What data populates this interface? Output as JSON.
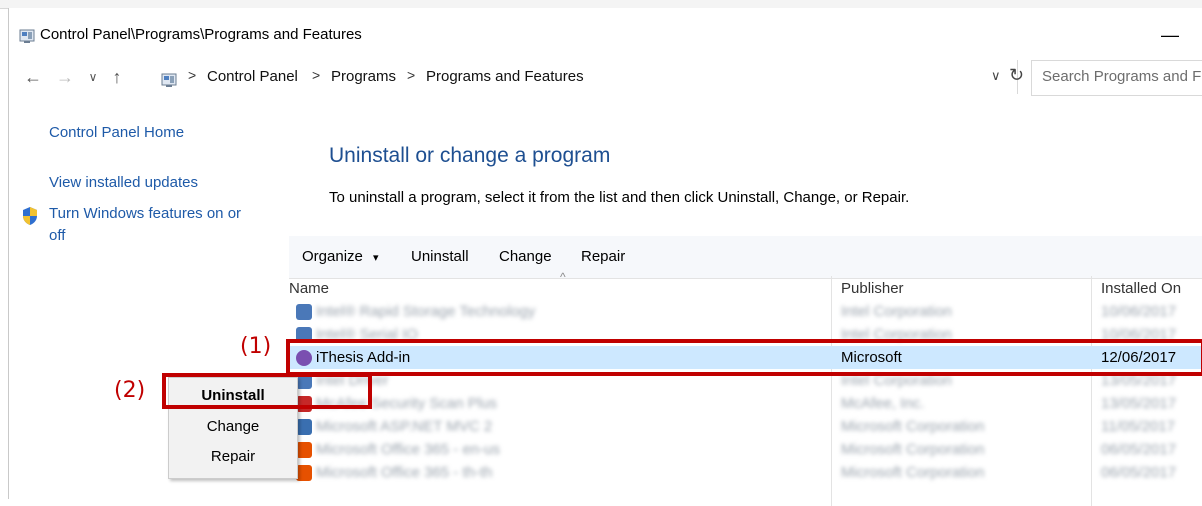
{
  "window": {
    "title": "Control Panel\\Programs\\Programs and Features",
    "minimize_label": "—"
  },
  "address": {
    "crumbs": [
      "Control Panel",
      "Programs",
      "Programs and Features"
    ],
    "separator": ">",
    "dropdown_glyph": "∨",
    "refresh_glyph": "↻",
    "nav": {
      "back": "←",
      "forward": "→",
      "recent": "∨",
      "up": "↑"
    }
  },
  "search": {
    "placeholder": "Search Programs and F"
  },
  "sidebar": {
    "items": [
      {
        "label": "Control Panel Home"
      },
      {
        "label": "View installed updates"
      },
      {
        "label": "Turn Windows features on or",
        "label2": "off",
        "icon": "shield-icon"
      }
    ]
  },
  "main": {
    "title": "Uninstall or change a program",
    "subtitle": "To uninstall a program, select it from the list and then click Uninstall, Change, or Repair."
  },
  "toolbar": {
    "organize": "Organize",
    "organize_caret": "▾",
    "uninstall": "Uninstall",
    "change": "Change",
    "repair": "Repair"
  },
  "table": {
    "columns": [
      "Name",
      "Publisher",
      "Installed On"
    ],
    "sort_glyph": "^",
    "rows": [
      {
        "name": "Intel® Rapid Storage Technology",
        "publisher": "Intel Corporation",
        "date": "10/06/2017",
        "blurred": true,
        "icon_color": "#4a78b8"
      },
      {
        "name": "Intel® Serial IO",
        "publisher": "Intel Corporation",
        "date": "10/06/2017",
        "blurred": true,
        "icon_color": "#4a78b8"
      },
      {
        "name": "iThesis Add-in",
        "publisher": "Microsoft",
        "date": "12/06/2017",
        "blurred": false,
        "selected": true,
        "icon_color": "#7a4fb0"
      },
      {
        "name": "Intel Driver",
        "publisher": "Intel Corporation",
        "date": "13/05/2017",
        "blurred": true,
        "icon_color": "#4a78b8"
      },
      {
        "name": "McAfee Security Scan Plus",
        "publisher": "McAfee, Inc.",
        "date": "13/05/2017",
        "blurred": true,
        "icon_color": "#c62828"
      },
      {
        "name": "Microsoft ASP.NET MVC 2",
        "publisher": "Microsoft Corporation",
        "date": "11/05/2017",
        "blurred": true,
        "icon_color": "#3a6fb0"
      },
      {
        "name": "Microsoft Office 365 - en-us",
        "publisher": "Microsoft Corporation",
        "date": "06/05/2017",
        "blurred": true,
        "icon_color": "#e65100"
      },
      {
        "name": "Microsoft Office 365 - th-th",
        "publisher": "Microsoft Corporation",
        "date": "06/05/2017",
        "blurred": true,
        "icon_color": "#e65100"
      }
    ]
  },
  "context_menu": {
    "items": [
      "Uninstall",
      "Change",
      "Repair"
    ]
  },
  "annotations": {
    "step1": "(1)",
    "step2": "(2)",
    "color": "#c00000"
  }
}
